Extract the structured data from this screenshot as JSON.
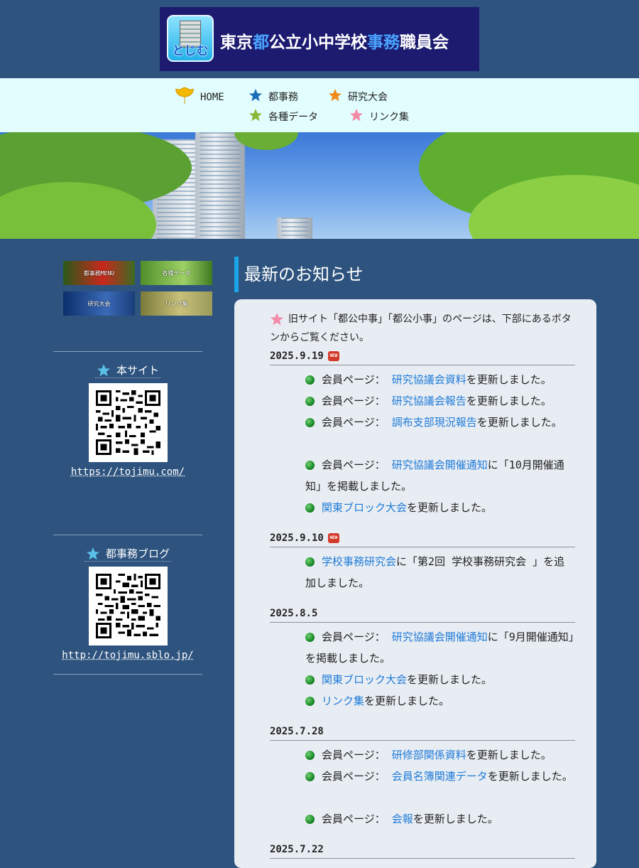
{
  "header": {
    "logo_text": "とじむ",
    "title_parts": [
      {
        "text": "東京",
        "hl": false
      },
      {
        "text": "都",
        "hl": true
      },
      {
        "text": "公立小中学校",
        "hl": false
      },
      {
        "text": "事務",
        "hl": true
      },
      {
        "text": "職員会",
        "hl": false
      }
    ]
  },
  "nav": {
    "home": "HOME",
    "tojimu": "都事務",
    "kenkyu": "研究大会",
    "data": "各種データ",
    "links": "リンク集"
  },
  "sidebar": {
    "thumbs": [
      "都事務MENU",
      "各種データ",
      "研究大会",
      "リンク集"
    ],
    "site_title": "本サイト",
    "site_url": "https://tojimu.com/",
    "blog_title": "都事務ブログ",
    "blog_url": "http://tojimu.sblo.jp/"
  },
  "main": {
    "heading": "最新のお知らせ",
    "intro": "旧サイト「都公中事」「都公小事」のページは、下部にあるボタンからご覧ください。",
    "new_badge": "NEW",
    "member_prefix": "会員ページ：",
    "sections": [
      {
        "date": "2025.9.19",
        "items": [
          {
            "link": "研究協議会資料",
            "text": "を更新しました。"
          },
          {
            "link": "研究協議会報告",
            "text": "を更新しました。"
          },
          {
            "link": "調布支部現況報告",
            "text": "を更新しました。"
          },
          {
            "link": "研究協議会開催通知",
            "text": "に「10月開催通知」を掲載しました。"
          },
          {
            "link": "関東ブロック大会",
            "text": "を更新しました。"
          }
        ]
      },
      {
        "date": "2025.9.10",
        "items": [
          {
            "link": "学校事務研究会",
            "text": "に「第2回 学校事務研究会 」を追加しました。"
          }
        ]
      },
      {
        "date": "2025.8.5",
        "items": [
          {
            "link": "研究協議会開催通知",
            "text": "に「9月開催通知」を掲載しました。"
          },
          {
            "link": "関東ブロック大会",
            "text": "を更新しました。"
          },
          {
            "link": "リンク集",
            "text": "を更新しました。"
          }
        ]
      },
      {
        "date": "2025.7.28",
        "items": [
          {
            "link": "研修部関係資料",
            "text": "を更新しました。"
          },
          {
            "link": "会員名簿関連データ",
            "text": "を更新しました。"
          },
          {
            "link": "会報",
            "text": "を更新しました。"
          }
        ]
      },
      {
        "date": "2025.7.22",
        "items": []
      }
    ]
  },
  "colors": {
    "page_bg": "#2d537e",
    "nav_bg": "#e2fdfd",
    "card_bg": "#e8edf3",
    "link": "#1f7bd8",
    "accent": "#1aa6e8"
  }
}
